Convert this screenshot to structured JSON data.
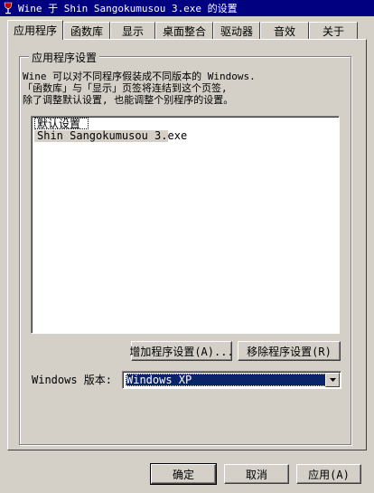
{
  "window": {
    "title": "Wine 于 Shin Sangokumusou 3.exe 的设置",
    "icon": "wine-glass-icon"
  },
  "tabs": [
    {
      "label": "应用程序",
      "active": true
    },
    {
      "label": "函数库",
      "active": false
    },
    {
      "label": "显示",
      "active": false
    },
    {
      "label": "桌面整合",
      "active": false
    },
    {
      "label": "驱动器",
      "active": false
    },
    {
      "label": "音效",
      "active": false
    },
    {
      "label": "关于",
      "active": false
    }
  ],
  "app_settings": {
    "group_title": "应用程序设置",
    "description": [
      "Wine 可以对不同程序假装成不同版本的 Windows.",
      "「函数库」与「显示」页签将连结到这个页签,",
      "除了调整默认设置, 也能调整个别程序的设置。"
    ],
    "list_items": [
      "默认设置",
      "Shin Sangokumusou 3.exe"
    ],
    "selected_index": 0,
    "add_button": "增加程序设置(A)...",
    "remove_button": "移除程序设置(R)",
    "windows_version_label": "Windows 版本:",
    "windows_version_value": "Windows XP"
  },
  "footer": {
    "ok": "确定",
    "cancel": "取消",
    "apply": "应用(A)"
  },
  "colors": {
    "face": "#d4d0c8",
    "titlebar": "#000080",
    "selection": "#0a246a"
  }
}
